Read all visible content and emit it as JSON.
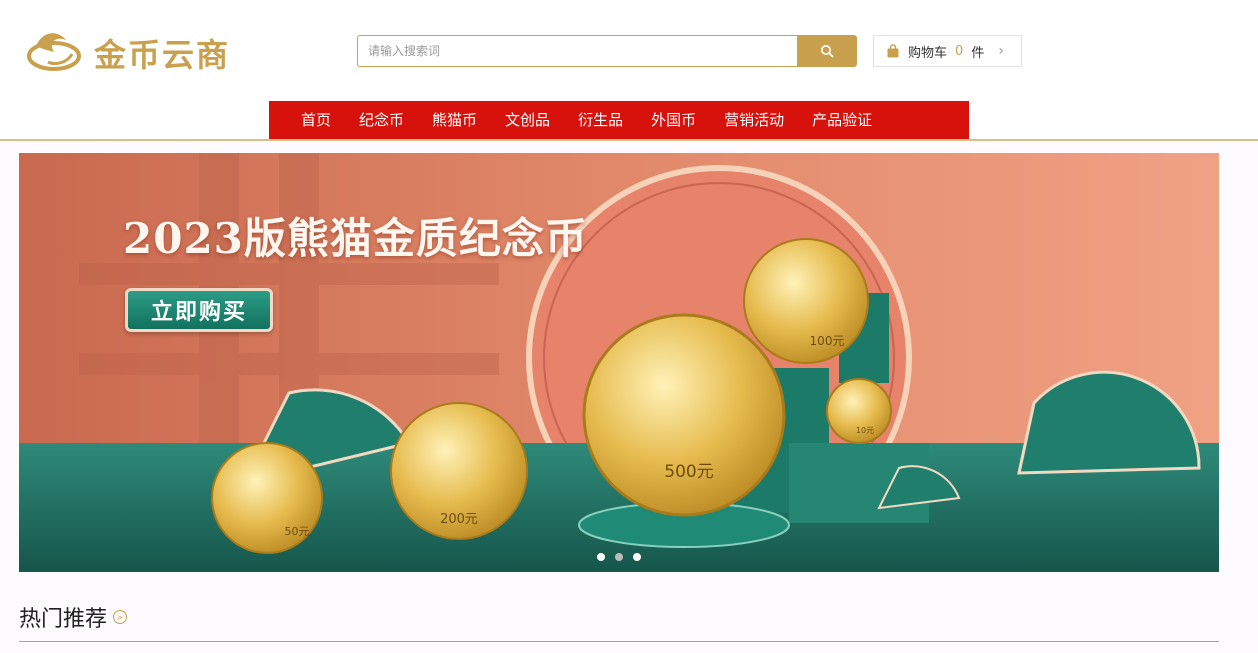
{
  "header": {
    "logo_text": "金币云商",
    "search": {
      "placeholder": "请输入搜索词"
    },
    "cart": {
      "label": "购物车",
      "count": "0",
      "unit": "件"
    }
  },
  "nav": {
    "items": [
      "首页",
      "纪念币",
      "熊猫币",
      "文创品",
      "衍生品",
      "外国币",
      "营销活动",
      "产品验证"
    ]
  },
  "banner": {
    "headline": "2023版熊猫金质纪念币",
    "buy_label": "立即购买",
    "coin_labels": [
      "50元",
      "200元",
      "500元",
      "100元",
      "10元"
    ],
    "slides": 3,
    "active_slide": 1
  },
  "section": {
    "title": "热门推荐"
  },
  "colors": {
    "accent": "#c9a14e",
    "nav_red": "#d7120c",
    "teal": "#1b7a68"
  }
}
